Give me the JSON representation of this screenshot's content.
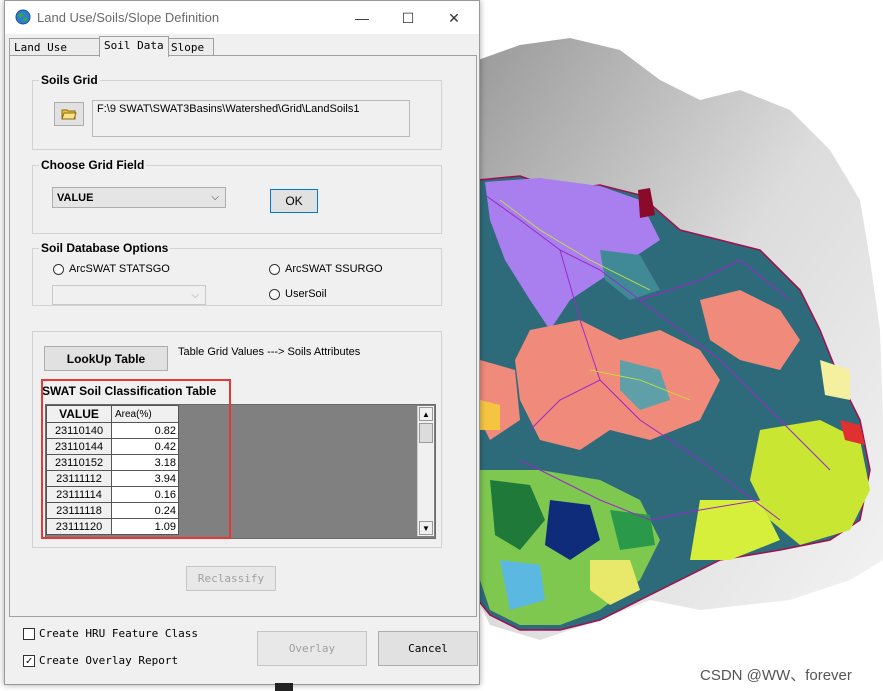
{
  "window": {
    "title": "Land Use/Soils/Slope Definition",
    "minimize": "—",
    "maximize": "☐",
    "close": "✕"
  },
  "tabs": [
    {
      "label": "Land Use Data",
      "active": false
    },
    {
      "label": "Soil Data",
      "active": true
    },
    {
      "label": "Slope",
      "active": false
    }
  ],
  "soils_grid": {
    "title": "Soils Grid",
    "path": "F:\\9 SWAT\\SWAT3Basins\\Watershed\\Grid\\LandSoils1"
  },
  "grid_field": {
    "title": "Choose Grid Field",
    "selected": "VALUE",
    "ok_label": "OK"
  },
  "db_options": {
    "title": "Soil Database Options",
    "statsgo": "ArcSWAT STATSGO",
    "ssurgo": "ArcSWAT SSURGO",
    "usersoil": "UserSoil"
  },
  "lookup": {
    "button": "LookUp Table",
    "caption": "Table Grid Values ---> Soils Attributes"
  },
  "classification": {
    "title": "SWAT Soil Classification Table",
    "headers": {
      "value": "VALUE",
      "area": "Area(%)"
    },
    "rows": [
      {
        "value": "23110140",
        "area": "0.82"
      },
      {
        "value": "23110144",
        "area": "0.42"
      },
      {
        "value": "23110152",
        "area": "3.18"
      },
      {
        "value": "23111112",
        "area": "3.94"
      },
      {
        "value": "23111114",
        "area": "0.16"
      },
      {
        "value": "23111118",
        "area": "0.24"
      },
      {
        "value": "23111120",
        "area": "1.09"
      }
    ],
    "scroll_up": "▲",
    "scroll_down": "▼"
  },
  "reclassify_label": "Reclassify",
  "bottom": {
    "create_hru": "Create HRU Feature Class",
    "create_report": "Create Overlay Report",
    "report_checked": "✓",
    "overlay_label": "Overlay",
    "cancel_label": "Cancel"
  },
  "watermark": "CSDN @WW、forever",
  "colors": {
    "highlight": "#e53935",
    "teal": "#2e6b7a",
    "salmon": "#f08a7a",
    "purple": "#a97ff0",
    "yellow_green": "#c8e632"
  }
}
